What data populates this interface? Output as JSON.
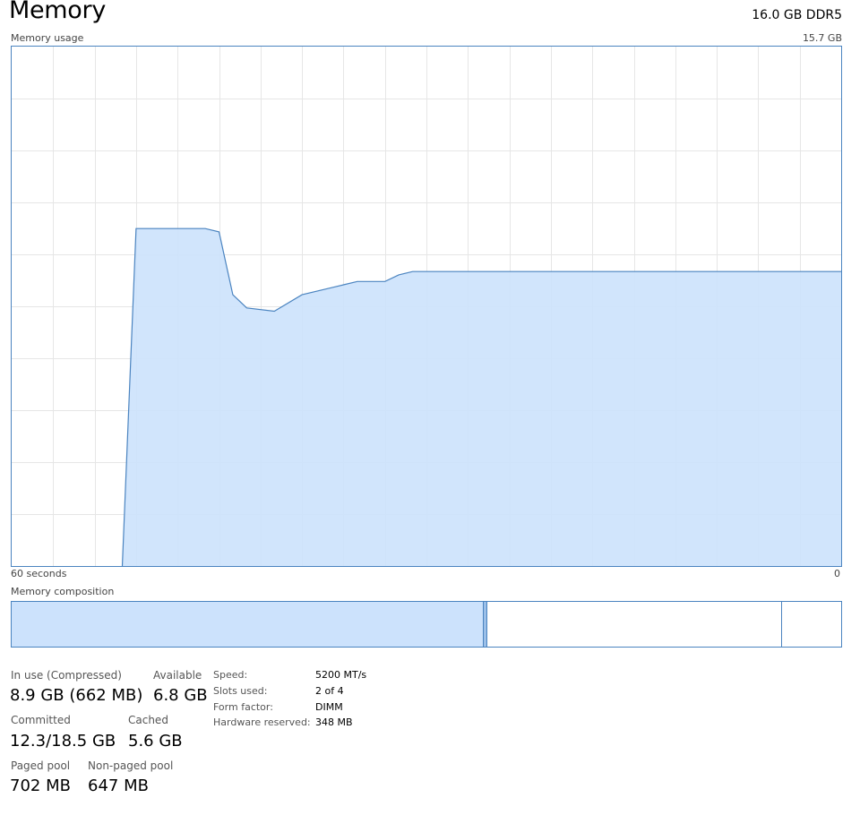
{
  "header": {
    "title": "Memory",
    "spec": "16.0 GB DDR5"
  },
  "graph": {
    "usage_label": "Memory usage",
    "max_label": "15.7 GB",
    "axis_left": "60 seconds",
    "axis_right": "0"
  },
  "composition": {
    "label": "Memory composition"
  },
  "stats": {
    "in_use": {
      "label": "In use (Compressed)",
      "value": "8.9 GB (662 MB)"
    },
    "available": {
      "label": "Available",
      "value": "6.8 GB"
    },
    "committed": {
      "label": "Committed",
      "value": "12.3/18.5 GB"
    },
    "cached": {
      "label": "Cached",
      "value": "5.6 GB"
    },
    "paged_pool": {
      "label": "Paged pool",
      "value": "702 MB"
    },
    "non_paged_pool": {
      "label": "Non-paged pool",
      "value": "647 MB"
    }
  },
  "info": {
    "speed": {
      "label": "Speed:",
      "value": "5200 MT/s"
    },
    "slots_used": {
      "label": "Slots used:",
      "value": "2 of 4"
    },
    "form_factor": {
      "label": "Form factor:",
      "value": "DIMM"
    },
    "hardware_reserved": {
      "label": "Hardware reserved:",
      "value": "348 MB"
    }
  },
  "colors": {
    "line": "#4b84c0",
    "fill": "#cce2fc",
    "grid": "#e6e6e6"
  },
  "chart_data": {
    "type": "area",
    "x_range": [
      60,
      0
    ],
    "y_range_gb": [
      0,
      15.7
    ],
    "grid": true,
    "series": [
      {
        "x_seconds_ago": [
          52,
          51,
          46,
          45,
          44,
          43,
          41,
          39,
          37,
          36,
          35,
          34,
          33,
          32,
          31,
          30,
          29,
          28,
          20,
          14,
          8,
          1,
          0
        ],
        "values_gb": [
          0.0,
          10.2,
          10.2,
          10.1,
          8.2,
          7.8,
          7.7,
          8.2,
          8.4,
          8.5,
          8.6,
          8.6,
          8.6,
          8.8,
          8.9,
          8.9,
          8.9,
          8.9,
          8.9,
          8.9,
          8.9,
          8.9,
          8.9
        ]
      }
    ]
  }
}
